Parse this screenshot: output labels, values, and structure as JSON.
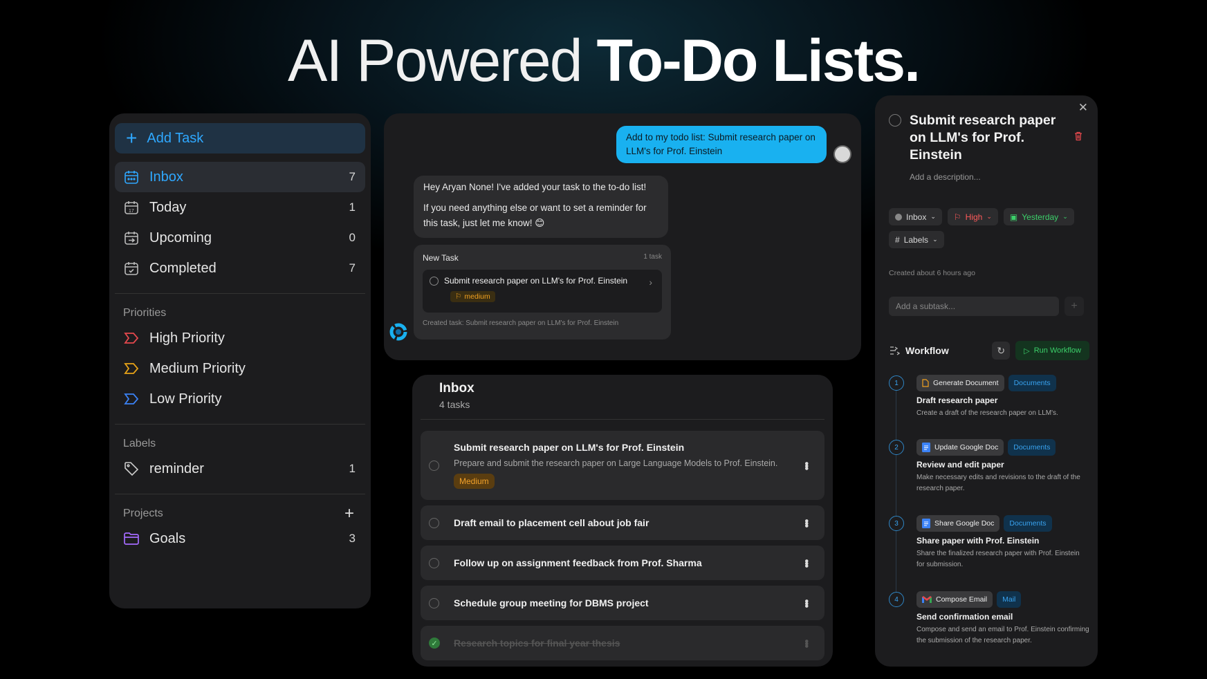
{
  "hero": {
    "light": "AI Powered",
    "bold": "To-Do Lists."
  },
  "sidebar": {
    "add_task": "Add Task",
    "nav": [
      {
        "label": "Inbox",
        "count": "7"
      },
      {
        "label": "Today",
        "count": "1"
      },
      {
        "label": "Upcoming",
        "count": "0"
      },
      {
        "label": "Completed",
        "count": "7"
      }
    ],
    "priorities_title": "Priorities",
    "priorities": [
      {
        "label": "High Priority",
        "color": "#e5484d"
      },
      {
        "label": "Medium Priority",
        "color": "#e8a317"
      },
      {
        "label": "Low Priority",
        "color": "#3b82f6"
      }
    ],
    "labels_title": "Labels",
    "labels": [
      {
        "label": "reminder",
        "count": "1"
      }
    ],
    "projects_title": "Projects",
    "projects": [
      {
        "label": "Goals",
        "count": "3",
        "color": "#a56bff"
      }
    ]
  },
  "chat": {
    "user_message": "Add to my todo list: Submit research paper on LLM's for Prof. Einstein",
    "bot_message_1": "Hey Aryan None! I've added your task to the to-do list!",
    "bot_message_2": "If you need anything else or want to set a reminder for this task, just let me know! 😊",
    "card": {
      "title": "New Task",
      "count": "1 task",
      "task": "Submit research paper on LLM's for Prof. Einstein",
      "priority": "medium",
      "footer": "Created task: Submit research paper on LLM's for Prof. Einstein"
    }
  },
  "inbox": {
    "title": "Inbox",
    "subtitle": "4 tasks",
    "tasks": [
      {
        "title": "Submit research paper on LLM's for Prof. Einstein",
        "description": "Prepare and submit the research paper on Large Language Models to Prof. Einstein.",
        "priority": "Medium"
      },
      {
        "title": "Draft email to placement cell about job fair"
      },
      {
        "title": "Follow up on assignment feedback from Prof. Sharma"
      },
      {
        "title": "Schedule group meeting for DBMS project"
      },
      {
        "title": "Research topics for final year thesis",
        "completed": true
      }
    ]
  },
  "detail": {
    "title": "Submit research paper on LLM's for Prof. Einstein",
    "description_placeholder": "Add a description...",
    "chips": {
      "project": "Inbox",
      "priority": "High",
      "date": "Yesterday",
      "labels": "Labels"
    },
    "created": "Created about 6 hours ago",
    "subtask_placeholder": "Add a subtask...",
    "workflow_title": "Workflow",
    "run_label": "Run Workflow",
    "steps": [
      {
        "num": "1",
        "action": "Generate Document",
        "tag": "Documents",
        "icon": "document-icon",
        "title": "Draft research paper",
        "desc": "Create a draft of the research paper on LLM's."
      },
      {
        "num": "2",
        "action": "Update Google Doc",
        "tag": "Documents",
        "icon": "google-doc-icon",
        "title": "Review and edit paper",
        "desc": "Make necessary edits and revisions to the draft of the research paper."
      },
      {
        "num": "3",
        "action": "Share Google Doc",
        "tag": "Documents",
        "icon": "google-doc-icon",
        "title": "Share paper with Prof. Einstein",
        "desc": "Share the finalized research paper with Prof. Einstein for submission."
      },
      {
        "num": "4",
        "action": "Compose Email",
        "tag": "Mail",
        "icon": "gmail-icon",
        "title": "Send confirmation email",
        "desc": "Compose and send an email to Prof. Einstein confirming the submission of the research paper."
      }
    ]
  }
}
